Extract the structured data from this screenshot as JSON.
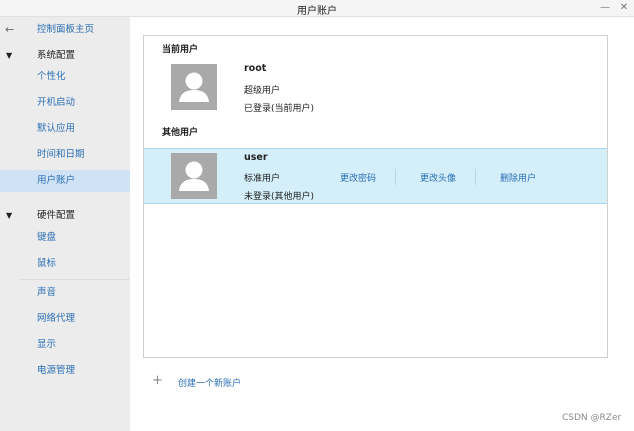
{
  "window": {
    "title": "用户账户"
  },
  "sidebar": {
    "home_label": "控制面板主页",
    "group_system": "系统配置",
    "system_items": [
      {
        "label": "个性化"
      },
      {
        "label": "开机启动"
      },
      {
        "label": "默认应用"
      },
      {
        "label": "时间和日期"
      },
      {
        "label": "用户账户"
      }
    ],
    "group_hardware": "硬件配置",
    "hardware_items": [
      {
        "label": "键盘"
      },
      {
        "label": "鼠标"
      },
      {
        "label": "声音"
      },
      {
        "label": "网络代理"
      },
      {
        "label": "显示"
      },
      {
        "label": "电源管理"
      }
    ],
    "active_item": "用户账户"
  },
  "current_users": {
    "title": "当前用户",
    "user": {
      "name": "root",
      "type": "超级用户",
      "status": "已登录(当前用户)"
    }
  },
  "other_users": {
    "title": "其他用户",
    "user": {
      "name": "user",
      "type": "标准用户",
      "status": "未登录(其他用户)",
      "actions": [
        "更改密码",
        "更改头像",
        "删除用户"
      ]
    }
  },
  "create_account_label": "创建一个新账户",
  "watermark": "CSDN @RZer",
  "icons": {
    "back": "arrow-left-icon",
    "minimize": "minimize-icon",
    "close": "close-icon",
    "expand": "triangle-down-icon",
    "avatar": "user-silhouette-icon",
    "add": "plus-icon"
  },
  "colors": {
    "link": "#2a6fb5",
    "sidebar_bg": "#ececec",
    "sidebar_active": "#cfe2f6",
    "selected_row": "#d4eefa",
    "avatar_bg": "#a9a9a9"
  }
}
